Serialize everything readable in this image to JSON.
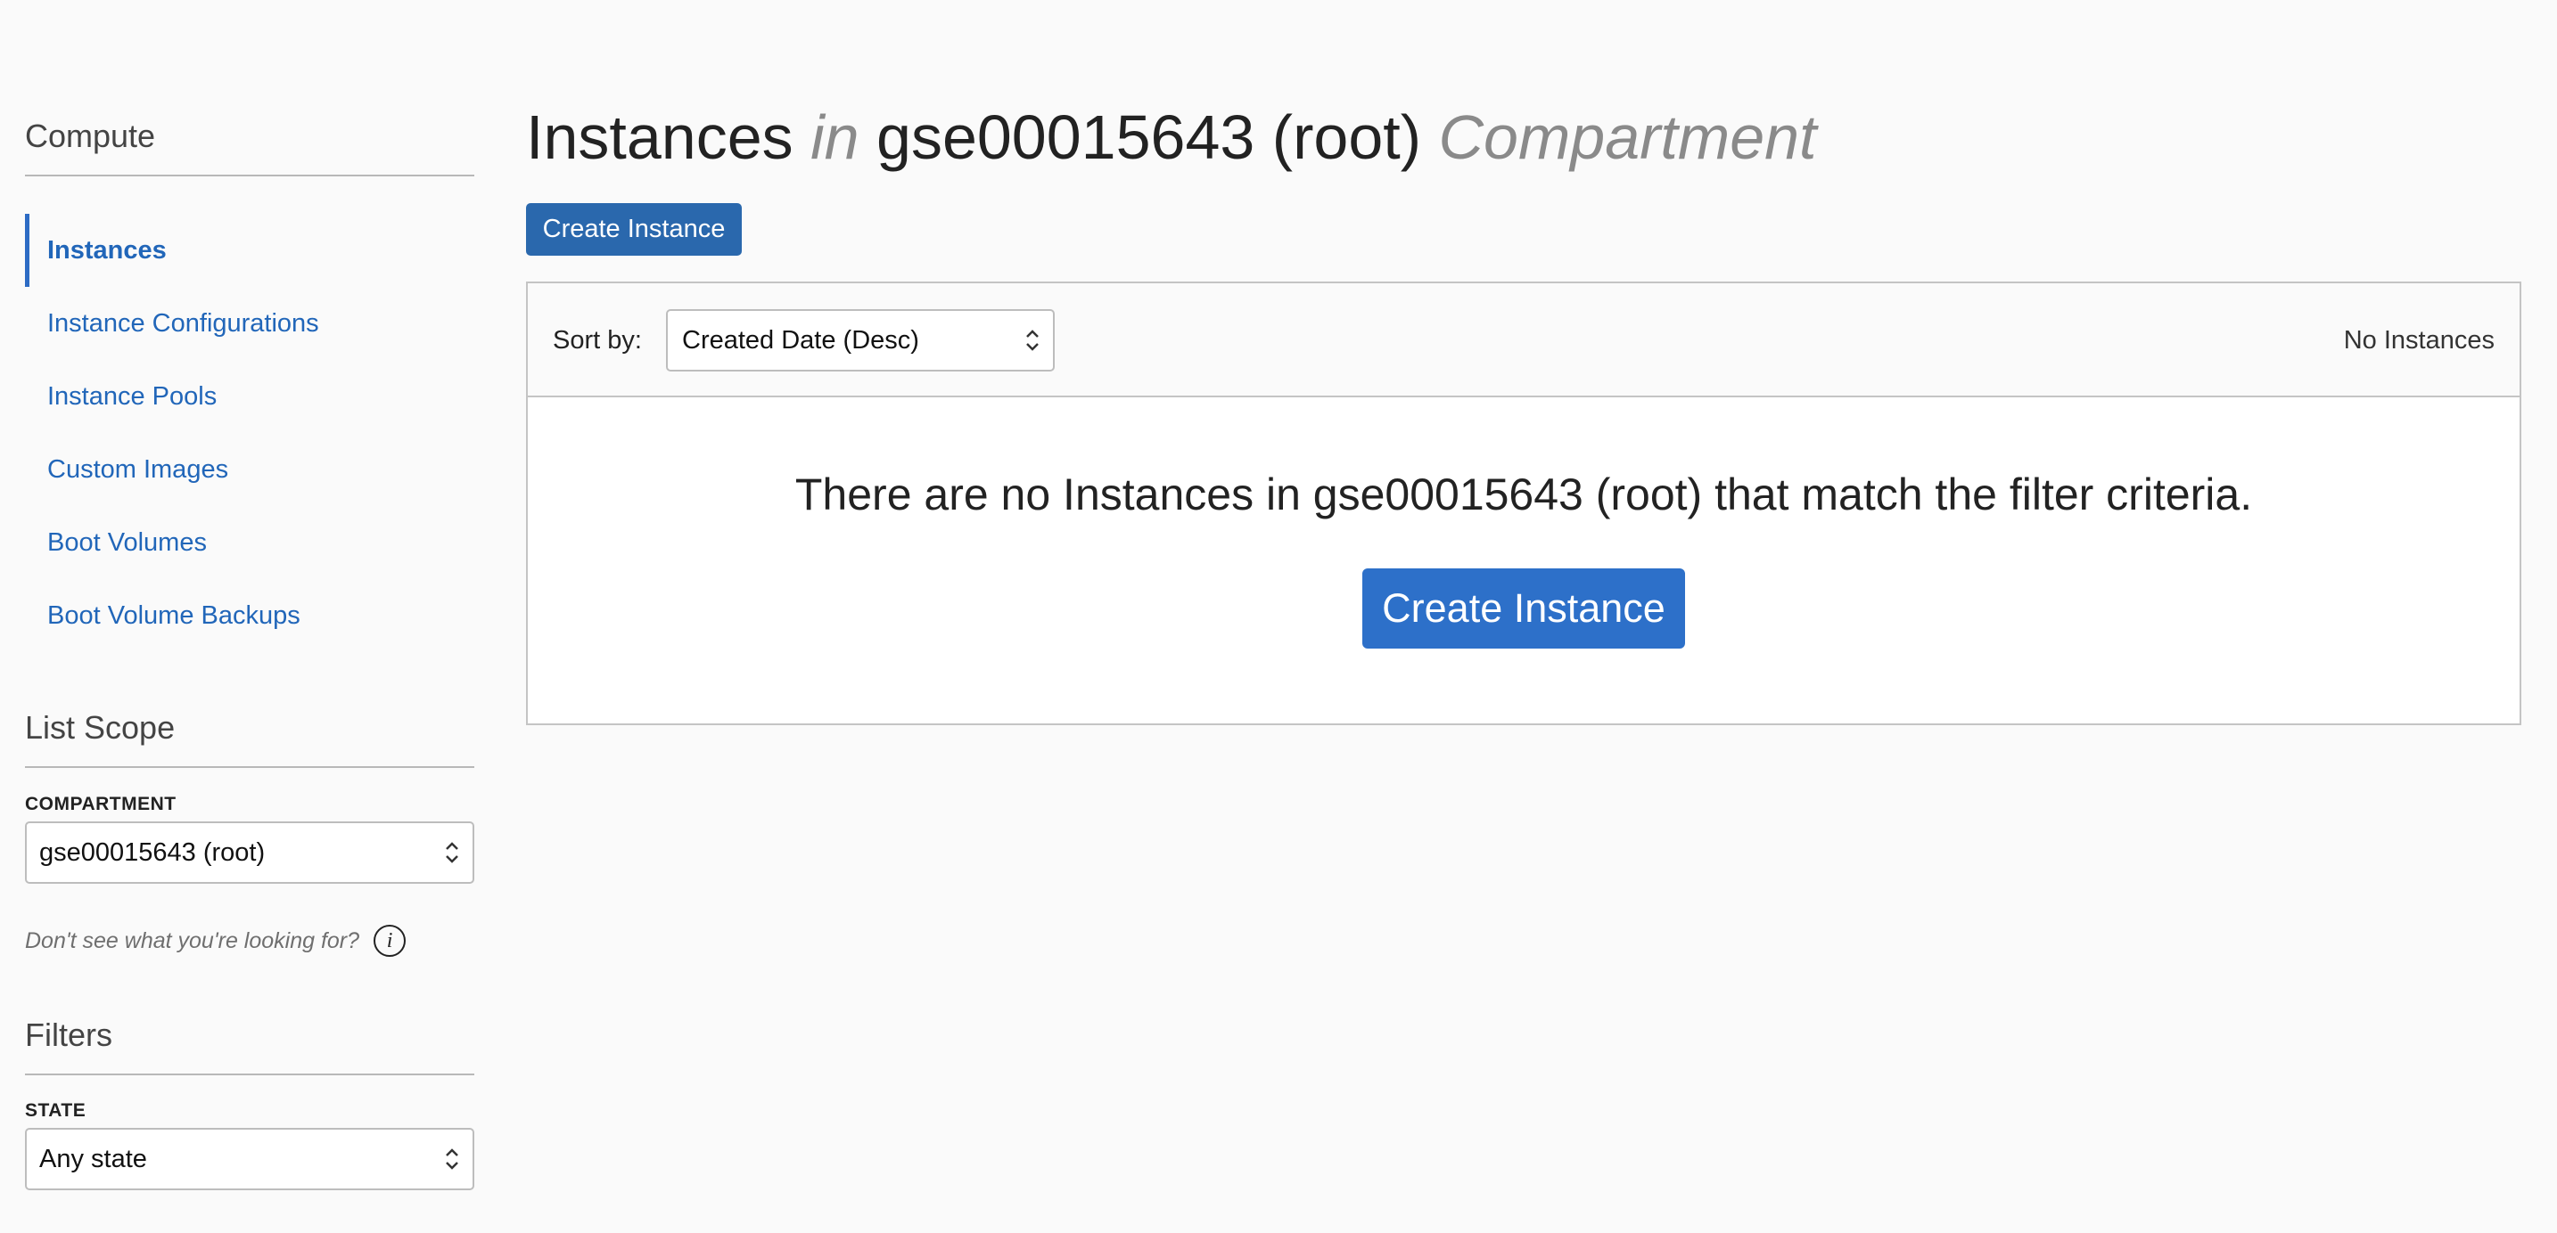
{
  "sidebar": {
    "compute_title": "Compute",
    "items": [
      {
        "label": "Instances",
        "active": true
      },
      {
        "label": "Instance Configurations"
      },
      {
        "label": "Instance Pools"
      },
      {
        "label": "Custom Images"
      },
      {
        "label": "Boot Volumes"
      },
      {
        "label": "Boot Volume Backups"
      }
    ],
    "list_scope": {
      "title": "List Scope",
      "compartment_label": "COMPARTMENT",
      "compartment_value": "gse00015643 (root)",
      "help_text": "Don't see what you're looking for?",
      "help_icon": "info-icon"
    },
    "filters": {
      "title": "Filters",
      "state_label": "STATE",
      "state_value": "Any state"
    }
  },
  "main": {
    "title": {
      "part1": "Instances",
      "part2": "in",
      "part3": "gse00015643 (root)",
      "part4": "Compartment"
    },
    "create_button_label": "Create Instance",
    "toolbar": {
      "sort_label": "Sort by:",
      "sort_value": "Created Date (Desc)",
      "count_text": "No Instances"
    },
    "empty": {
      "message": "There are no Instances in gse00015643 (root) that match the filter criteria.",
      "button_label": "Create Instance"
    }
  },
  "colors": {
    "accent": "#2d70c9",
    "link": "#2166b9",
    "muted": "#8a8a8a"
  }
}
